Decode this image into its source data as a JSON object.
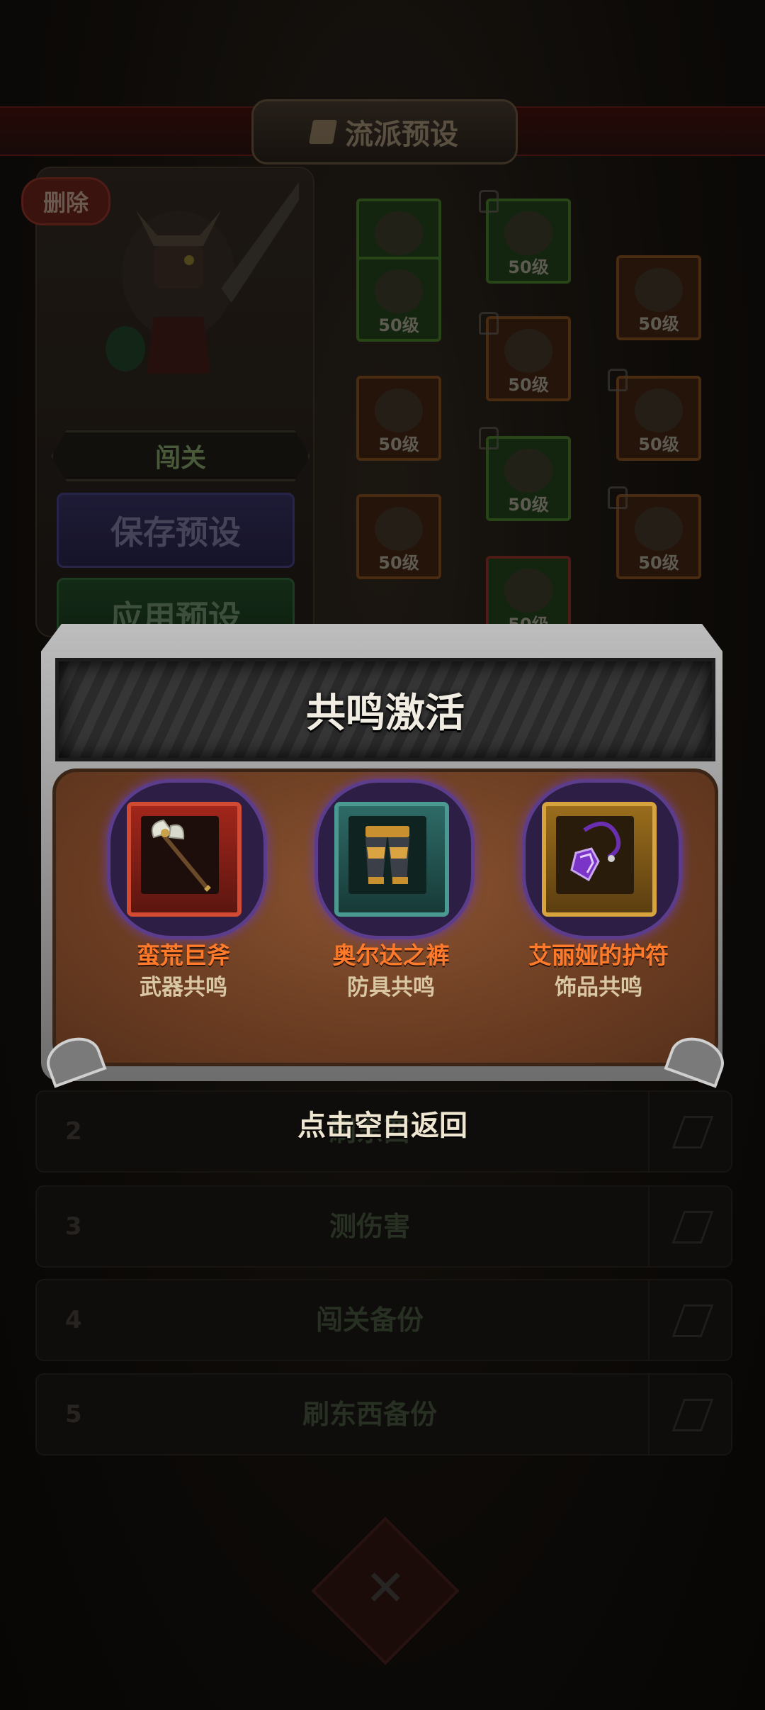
{
  "background": {
    "title": "流派预设",
    "delete_label": "删除",
    "mode_label": "闯关",
    "save_label": "保存预设",
    "apply_label": "应用预设",
    "equipment_level": "50级",
    "presets": [
      {
        "index": "2",
        "name": "刷东西"
      },
      {
        "index": "3",
        "name": "测伤害"
      },
      {
        "index": "4",
        "name": "闯关备份"
      },
      {
        "index": "5",
        "name": "刷东西备份"
      }
    ]
  },
  "popup": {
    "title": "共鸣激活",
    "items": [
      {
        "name": "蛮荒巨斧",
        "type": "武器共鸣",
        "icon": "axe-icon",
        "frame_color": "#d34a32"
      },
      {
        "name": "奥尔达之裤",
        "type": "防具共鸣",
        "icon": "armored-pants-icon",
        "frame_color": "#4a9a92"
      },
      {
        "name": "艾丽娅的护符",
        "type": "饰品共鸣",
        "icon": "amulet-icon",
        "frame_color": "#d7a33d"
      }
    ]
  },
  "hint": "点击空白返回"
}
